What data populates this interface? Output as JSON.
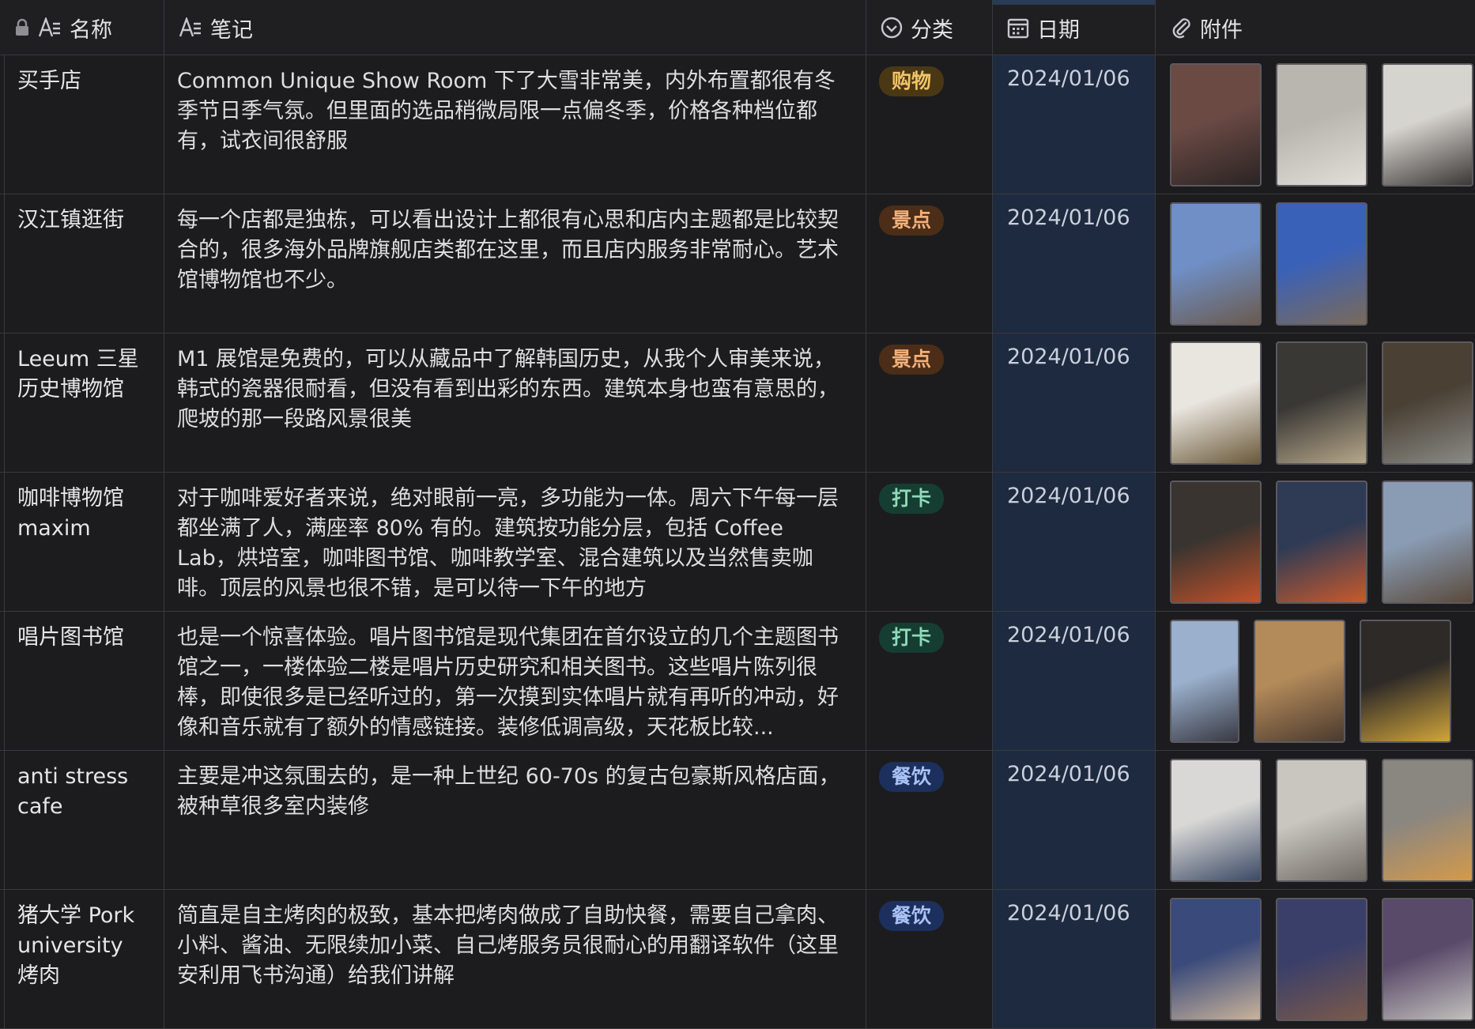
{
  "header": {
    "name": "名称",
    "note": "笔记",
    "category": "分类",
    "date": "日期",
    "attachment": "附件"
  },
  "tag_colors": {
    "购物": {
      "bg": "#4a3714",
      "fg": "#f0c46a"
    },
    "景点": {
      "bg": "#4b2d18",
      "fg": "#f3b07a"
    },
    "打卡": {
      "bg": "#163d31",
      "fg": "#8fd9b9"
    },
    "餐饮": {
      "bg": "#1d2f5c",
      "fg": "#a9c2f5"
    }
  },
  "rows": [
    {
      "name": "买手店",
      "note": "Common Unique Show Room 下了大雪非常美，内外布置都很有冬季节日季气氛。但里面的选品稍微局限一点偏冬季，价格各种档位都有，试衣间很舒服",
      "category": "购物",
      "date": "2024/01/06",
      "thumbs": [
        [
          "#6b4a44",
          "#2a2424"
        ],
        [
          "#b9b6b0",
          "#e2dfd9"
        ],
        [
          "#d6d4cf",
          "#3c3836"
        ]
      ]
    },
    {
      "name": "汉江镇逛街",
      "note": "每一个店都是独栋，可以看出设计上都很有心思和店内主题都是比较契合的，很多海外品牌旗舰店类都在这里，而且店内服务非常耐心。艺术馆博物馆也不少。",
      "category": "景点",
      "date": "2024/01/06",
      "thumbs": [
        [
          "#6f8fc6",
          "#6a5b4f"
        ],
        [
          "#3a61b8",
          "#7a6a5a"
        ]
      ]
    },
    {
      "name": "Leeum 三星历史博物馆",
      "note": "M1 展馆是免费的，可以从藏品中了解韩国历史，从我个人审美来说，韩式的瓷器很耐看，但没有看到出彩的东西。建筑本身也蛮有意思的，爬坡的那一段路风景很美",
      "category": "景点",
      "date": "2024/01/06",
      "thumbs": [
        [
          "#e9e5df",
          "#6b5a3a"
        ],
        [
          "#3a3835",
          "#b6a78a"
        ],
        [
          "#4a4034",
          "#8a8b86"
        ]
      ]
    },
    {
      "name": "咖啡博物馆 maxim",
      "note": "对于咖啡爱好者来说，绝对眼前一亮，多功能为一体。周六下午每一层都坐满了人，满座率 80% 有的。建筑按功能分层，包括 Coffee Lab，烘培室，咖啡图书馆、咖啡教学室、混合建筑以及当然售卖咖啡。顶层的风景也很不错，是可以待一下午的地方",
      "category": "打卡",
      "date": "2024/01/06",
      "thumbs": [
        [
          "#3a3430",
          "#c2522a"
        ],
        [
          "#2f3b55",
          "#c85a2c"
        ],
        [
          "#8a9cb4",
          "#5a4a3c"
        ]
      ]
    },
    {
      "name": "唱片图书馆",
      "note": "也是一个惊喜体验。唱片图书馆是现代集团在首尔设立的几个主题图书馆之一，一楼体验二楼是唱片历史研究和相关图书。这些唱片陈列很棒，即使很多是已经听过的，第一次摸到实体唱片就有再听的冲动，好像和音乐就有了额外的情感链接。装修低调高级，天花板比较...",
      "category": "打卡",
      "date": "2024/01/06",
      "thumbs": [
        [
          "#9ab0cc",
          "#3a3a44"
        ],
        [
          "#b38a5a",
          "#4a3a2e"
        ],
        [
          "#2e2a28",
          "#d1a53a"
        ]
      ],
      "narrow_first": true
    },
    {
      "name": "anti stress cafe",
      "note": "主要是冲这氛围去的，是一种上世纪 60-70s 的复古包豪斯风格店面，被种草很多室内装修",
      "category": "餐饮",
      "date": "2024/01/06",
      "thumbs": [
        [
          "#d9d8d6",
          "#3c4a66"
        ],
        [
          "#c9c6c0",
          "#6f6a62"
        ],
        [
          "#8a8680",
          "#d49a4a"
        ]
      ]
    },
    {
      "name": "猪大学 Pork university 烤肉",
      "note": "简直是自主烤肉的极致，基本把烤肉做成了自助快餐，需要自己拿肉、小料、酱油、无限续加小菜、自己烤服务员很耐心的用翻译软件（这里安利用飞书沟通）给我们讲解",
      "category": "餐饮",
      "date": "2024/01/06",
      "thumbs": [
        [
          "#3a4a7a",
          "#c9b39a"
        ],
        [
          "#3a3f6a",
          "#7a5a4a"
        ],
        [
          "#5a4a6a",
          "#c2c0bc"
        ]
      ]
    }
  ]
}
